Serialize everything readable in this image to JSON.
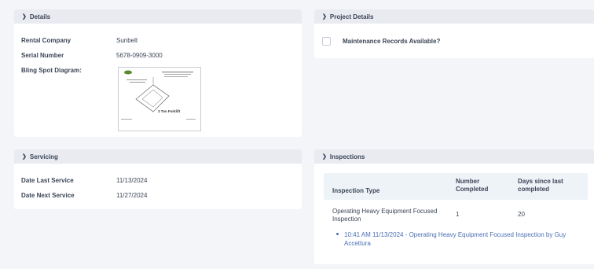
{
  "details": {
    "header": "Details",
    "fields": [
      {
        "label": "Rental Company",
        "value": "Sunbelt"
      },
      {
        "label": "Serial Number",
        "value": "5678-0909-3000"
      },
      {
        "label": "Bling Spot Diagram:",
        "value": ""
      }
    ],
    "diagram_caption": "3 Ton Forklift"
  },
  "project_details": {
    "header": "Project Details",
    "checkbox_label": "Maintenance Records Available?"
  },
  "servicing": {
    "header": "Servicing",
    "fields": [
      {
        "label": "Date Last Service",
        "value": "11/13/2024"
      },
      {
        "label": "Date Next Service",
        "value": "11/27/2024"
      }
    ]
  },
  "inspections": {
    "header": "Inspections",
    "columns": [
      "Inspection Type",
      "Number Completed",
      "Days since last completed"
    ],
    "rows": [
      {
        "type": "Operating Heavy Equipment Focused Inspection",
        "completed": "1",
        "days": "20"
      }
    ],
    "entries": [
      "10:41 AM 11/13/2024 - Operating Heavy Equipment Focused Inspection by Guy Accettura"
    ]
  },
  "icons": {
    "chevron": "chevron-down-icon",
    "bullet": "bullet-icon"
  }
}
